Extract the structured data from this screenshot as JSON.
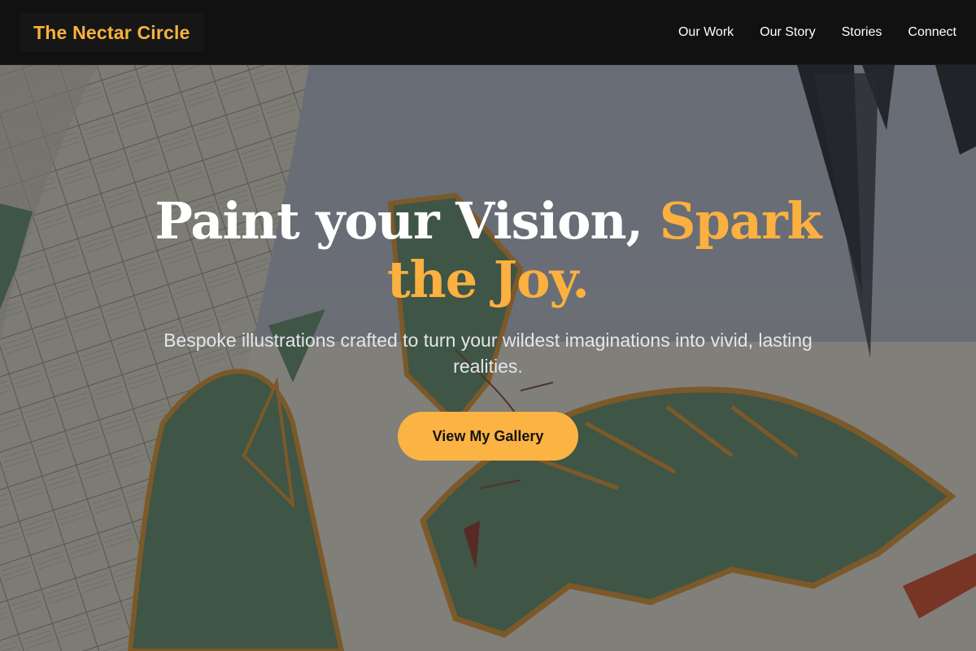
{
  "brand": {
    "name": "The Nectar Circle"
  },
  "nav": {
    "items": [
      {
        "label": "Our Work"
      },
      {
        "label": "Our Story"
      },
      {
        "label": "Stories"
      },
      {
        "label": "Connect"
      }
    ]
  },
  "hero": {
    "headline_main": "Paint your Vision, ",
    "headline_accent": "Spark the Joy.",
    "tagline": "Bespoke illustrations crafted to turn your wildest imaginations into vivid, lasting realities.",
    "cta_label": "View My Gallery"
  },
  "colors": {
    "accent": "#fbb03f",
    "navbar_bg": "#0e0e0e",
    "text_primary": "#ffffff",
    "leaf_green": "#5f8466",
    "leaf_outline": "#c88a34"
  }
}
